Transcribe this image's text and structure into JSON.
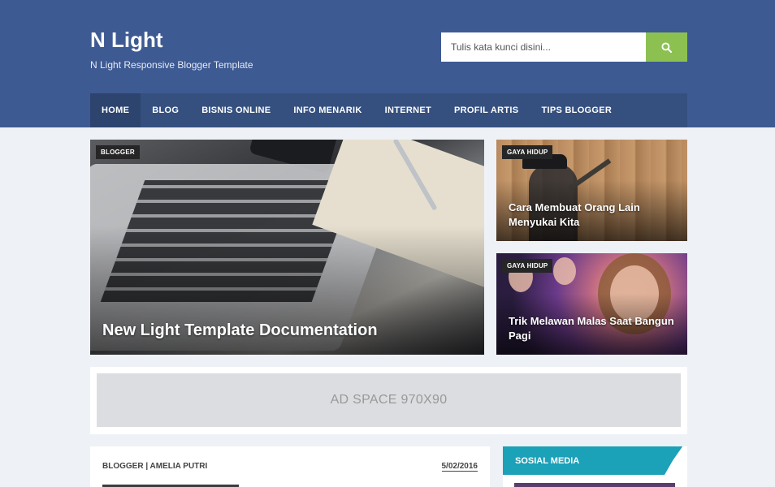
{
  "site": {
    "title": "N Light",
    "description": "N Light Responsive Blogger Template"
  },
  "search": {
    "placeholder": "Tulis kata kunci disini...",
    "icon": "search-icon"
  },
  "nav": {
    "items": [
      {
        "label": "HOME",
        "active": true
      },
      {
        "label": "BLOG"
      },
      {
        "label": "BISNIS ONLINE"
      },
      {
        "label": "INFO MENARIK"
      },
      {
        "label": "INTERNET"
      },
      {
        "label": "PROFIL ARTIS"
      },
      {
        "label": "TIPS BLOGGER"
      }
    ]
  },
  "featured": {
    "main": {
      "tag": "BLOGGER",
      "title": "New Light Template Documentation"
    },
    "side": [
      {
        "tag": "GAYA HIDUP",
        "title": "Cara Membuat Orang Lain Menyukai Kita"
      },
      {
        "tag": "GAYA HIDUP",
        "title": "Trik Melawan Malas Saat Bangun Pagi"
      }
    ]
  },
  "ad": {
    "label": "AD SPACE 970X90"
  },
  "post": {
    "meta": "BLOGGER | AMELIA PUTRI",
    "date": "5/02/2016"
  },
  "widget": {
    "title": "SOSIAL MEDIA"
  },
  "colors": {
    "header": "#3d5a92",
    "nav": "#35507f",
    "search_button": "#8cc152",
    "widget_accent": "#1ba1b8"
  }
}
